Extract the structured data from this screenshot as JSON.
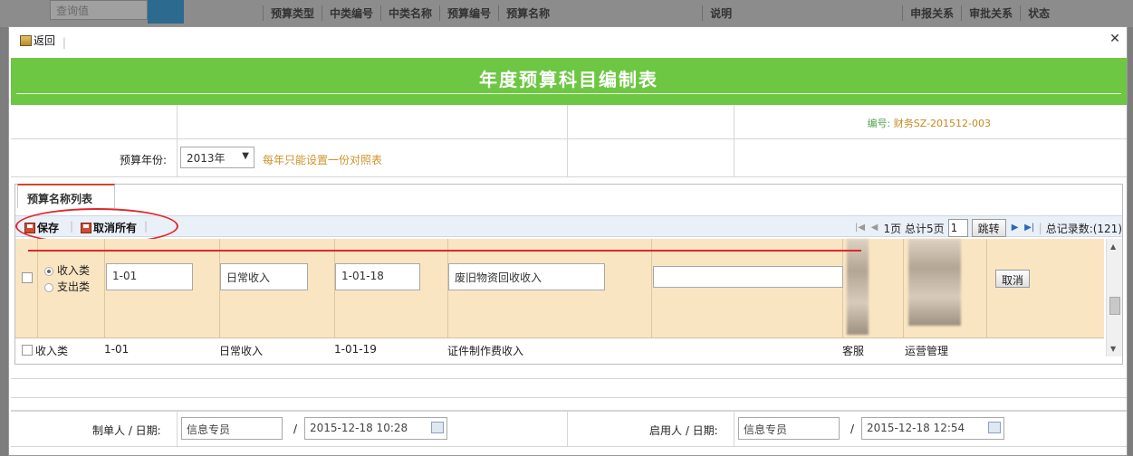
{
  "background": {
    "search_placeholder": "查询值",
    "headers": [
      "预算类型",
      "中类编号",
      "中类名称",
      "预算编号",
      "预算名称",
      "说明",
      "申报关系",
      "审批关系",
      "状态"
    ]
  },
  "dialog": {
    "back_label": "返回",
    "title": "年度预算科目编制表",
    "code_label": "编号:",
    "code_value": "财务SZ-201512-003",
    "budget_year_label": "预算年份:",
    "budget_year_value": "2013年",
    "budget_year_hint": "每年只能设置一份对照表",
    "tab_label": "预算名称列表",
    "save_label": "保存",
    "cancel_all_label": "取消所有",
    "pager": {
      "page_info": "1页 总计5页",
      "page_input": "1",
      "jump_label": "跳转",
      "total_label": "总记录数:(121)"
    },
    "edit_row": {
      "type_option_1": "收入类",
      "type_option_2": "支出类",
      "mid_code": "1-01",
      "mid_name": "日常收入",
      "budget_code": "1-01-18",
      "budget_name": "废旧物资回收收入",
      "note": "",
      "cancel_label": "取消"
    },
    "row2": {
      "type": "收入类",
      "mid_code": "1-01",
      "mid_name": "日常收入",
      "budget_code": "1-01-19",
      "budget_name": "证件制作费收入",
      "declare": "客服",
      "approve": "运营管理"
    },
    "creator_label": "制单人 / 日期:",
    "creator_value": "信息专员",
    "creator_date": "2015-12-18 10:28",
    "enabler_label": "启用人 / 日期:",
    "enabler_value": "信息专员",
    "enabler_date": "2015-12-18 12:54",
    "slash": "/"
  }
}
